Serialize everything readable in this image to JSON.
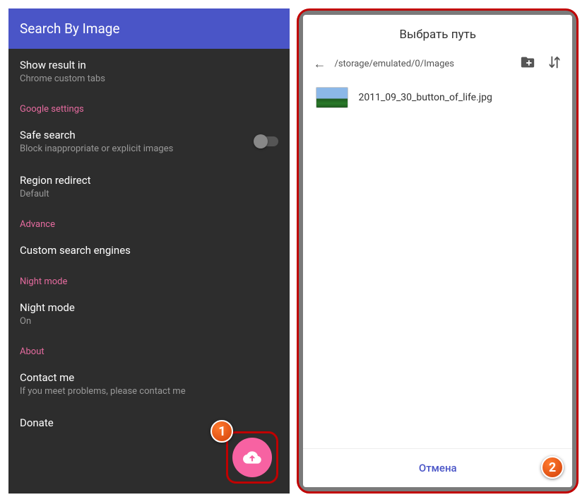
{
  "callouts": {
    "one": "1",
    "two": "2"
  },
  "left": {
    "appbar_title": "Search By Image",
    "items": [
      {
        "title": "Show result in",
        "subtitle": "Chrome custom tabs"
      }
    ],
    "google_header": "Google settings",
    "google_items": [
      {
        "title": "Safe search",
        "subtitle": "Block inappropriate or explicit images"
      },
      {
        "title": "Region redirect",
        "subtitle": "Default"
      }
    ],
    "advance_header": "Advance",
    "advance_items": [
      {
        "title": "Custom search engines"
      }
    ],
    "night_header": "Night mode",
    "night_items": [
      {
        "title": "Night mode",
        "subtitle": "On"
      }
    ],
    "about_header": "About",
    "about_items": [
      {
        "title": "Contact me",
        "subtitle": "If you meet problems, please contact me"
      },
      {
        "title": "Donate"
      }
    ]
  },
  "right": {
    "dialog_title": "Выбрать путь",
    "path": "/storage/emulated/0/Images",
    "files": [
      {
        "name": "2011_09_30_button_of_life.jpg"
      }
    ],
    "cancel": "Отмена"
  }
}
